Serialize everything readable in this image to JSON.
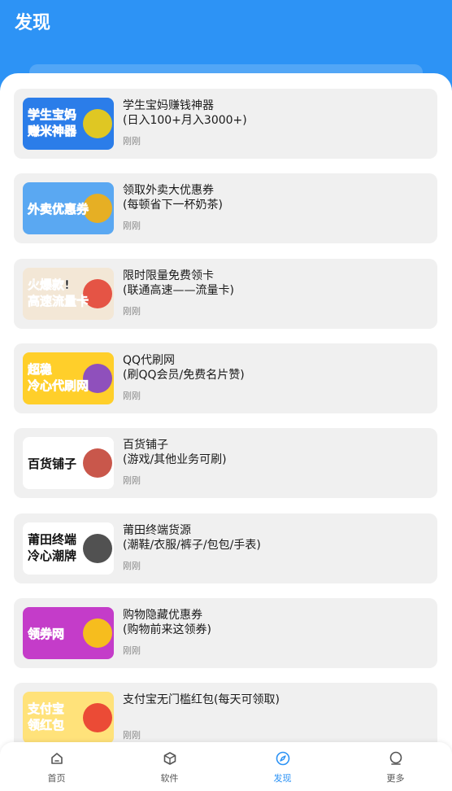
{
  "header": {
    "title": "发现"
  },
  "items": [
    {
      "title": "学生宝妈赚钱神器",
      "subtitle": "(日入100+月入3000+)",
      "time": "刚刚",
      "thumb_text": "学生宝妈 赚米神器",
      "thumb_bg": "#2b7de9",
      "thumb_accent": "#ffd400",
      "thumb_fg": "#e8202a"
    },
    {
      "title": "领取外卖大优惠券",
      "subtitle": "(每顿省下一杯奶茶)",
      "time": "刚刚",
      "thumb_text": "外卖优惠券",
      "thumb_bg": "#5aa8f2",
      "thumb_accent": "#ffb000",
      "thumb_fg": "#ffffff"
    },
    {
      "title": "限时限量免费领卡",
      "subtitle": "(联通高速——流量卡)",
      "time": "刚刚",
      "thumb_text": "火爆款! 高速流量卡",
      "thumb_bg": "#f3e7d6",
      "thumb_accent": "#e23a2b",
      "thumb_fg": "#111111"
    },
    {
      "title": "QQ代刷网",
      "subtitle": "(刷QQ会员/免费名片赞)",
      "time": "刚刚",
      "thumb_text": "超稳 冷心代刷网",
      "thumb_bg": "#ffcf2a",
      "thumb_accent": "#7b39d6",
      "thumb_fg": "#111111"
    },
    {
      "title": "百货铺子",
      "subtitle": "(游戏/其他业务可刷)",
      "time": "刚刚",
      "thumb_text": "百货铺子",
      "thumb_bg": "#ffffff",
      "thumb_accent": "#c0392b",
      "thumb_fg": "#111111"
    },
    {
      "title": "莆田终端货源",
      "subtitle": "(潮鞋/衣服/裤子/包包/手表)",
      "time": "刚刚",
      "thumb_text": "莆田终端 冷心潮牌",
      "thumb_bg": "#ffffff",
      "thumb_accent": "#333333",
      "thumb_fg": "#111111"
    },
    {
      "title": "购物隐藏优惠券",
      "subtitle": "(购物前来这领券)",
      "time": "刚刚",
      "thumb_text": "领券网",
      "thumb_bg": "#c43cc9",
      "thumb_accent": "#ffd400",
      "thumb_fg": "#ffffff"
    },
    {
      "title": "支付宝无门槛红包(每天可领取)",
      "subtitle": "",
      "time": "刚刚",
      "thumb_text": "支付宝 领红包",
      "thumb_bg": "#ffe27a",
      "thumb_accent": "#e7302a",
      "thumb_fg": "#1f6fe5"
    }
  ],
  "tabbar": [
    {
      "label": "首页",
      "icon": "home-icon",
      "active": false
    },
    {
      "label": "软件",
      "icon": "box-icon",
      "active": false
    },
    {
      "label": "发现",
      "icon": "compass-icon",
      "active": true
    },
    {
      "label": "更多",
      "icon": "more-icon",
      "active": false
    }
  ],
  "colors": {
    "primary": "#2d93f5",
    "card_bg": "#f0f0f0",
    "time_gray": "#8a8a8a"
  }
}
